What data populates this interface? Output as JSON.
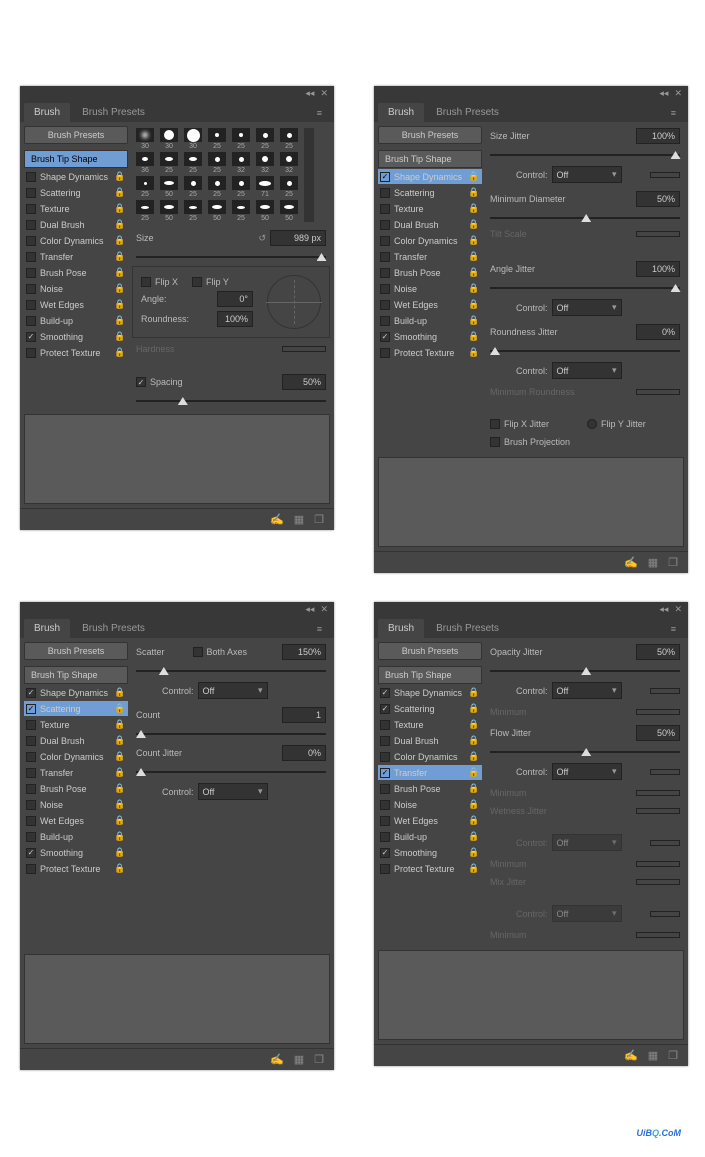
{
  "ui": {
    "tabs": {
      "brush": "Brush",
      "presets": "Brush Presets"
    },
    "collapse": "◂◂",
    "close": "✕",
    "menu": "≡",
    "btn_presets": "Brush Presets",
    "btn_tipshape": "Brush Tip Shape",
    "options": [
      {
        "label": "Shape Dynamics"
      },
      {
        "label": "Scattering"
      },
      {
        "label": "Texture"
      },
      {
        "label": "Dual Brush"
      },
      {
        "label": "Color Dynamics"
      },
      {
        "label": "Transfer"
      },
      {
        "label": "Brush Pose"
      },
      {
        "label": "Noise"
      },
      {
        "label": "Wet Edges"
      },
      {
        "label": "Build-up"
      },
      {
        "label": "Smoothing"
      },
      {
        "label": "Protect Texture"
      }
    ],
    "footer": {
      "pen": "✍",
      "grid": "▦",
      "new": "❐"
    }
  },
  "tip": {
    "sizes": [
      30,
      30,
      30,
      25,
      25,
      25,
      25,
      36,
      25,
      25,
      25,
      32,
      32,
      32,
      25,
      50,
      25,
      25,
      25,
      71,
      25,
      25,
      50,
      25,
      50,
      25,
      50,
      50
    ],
    "size_lbl": "Size",
    "size_val": "989 px",
    "reset": "↺",
    "flipx": "Flip X",
    "flipy": "Flip Y",
    "angle": "Angle:",
    "angle_val": "0°",
    "round": "Roundness:",
    "round_val": "100%",
    "hard": "Hardness",
    "spacing": "Spacing",
    "spacing_val": "50%"
  },
  "dyn": {
    "sizej": "Size Jitter",
    "sizej_v": "100%",
    "control": "Control:",
    "off": "Off",
    "mind": "Minimum Diameter",
    "mind_v": "50%",
    "tilt": "Tilt Scale",
    "angj": "Angle Jitter",
    "angj_v": "100%",
    "rndj": "Roundness Jitter",
    "rndj_v": "0%",
    "minr": "Minimum Roundness",
    "flipxj": "Flip X Jitter",
    "flipyj": "Flip Y Jitter",
    "brushproj": "Brush Projection"
  },
  "scat": {
    "scatter": "Scatter",
    "both": "Both Axes",
    "scatter_v": "150%",
    "control": "Control:",
    "off": "Off",
    "count": "Count",
    "count_v": "1",
    "countj": "Count Jitter",
    "countj_v": "0%"
  },
  "trans": {
    "opj": "Opacity Jitter",
    "opj_v": "50%",
    "control": "Control:",
    "off": "Off",
    "min": "Minimum",
    "flj": "Flow Jitter",
    "flj_v": "50%",
    "wet": "Wetness Jitter",
    "mix": "Mix Jitter"
  },
  "watermark": {
    "a": "UiB",
    "b": "Q",
    "c": ".CoM"
  }
}
